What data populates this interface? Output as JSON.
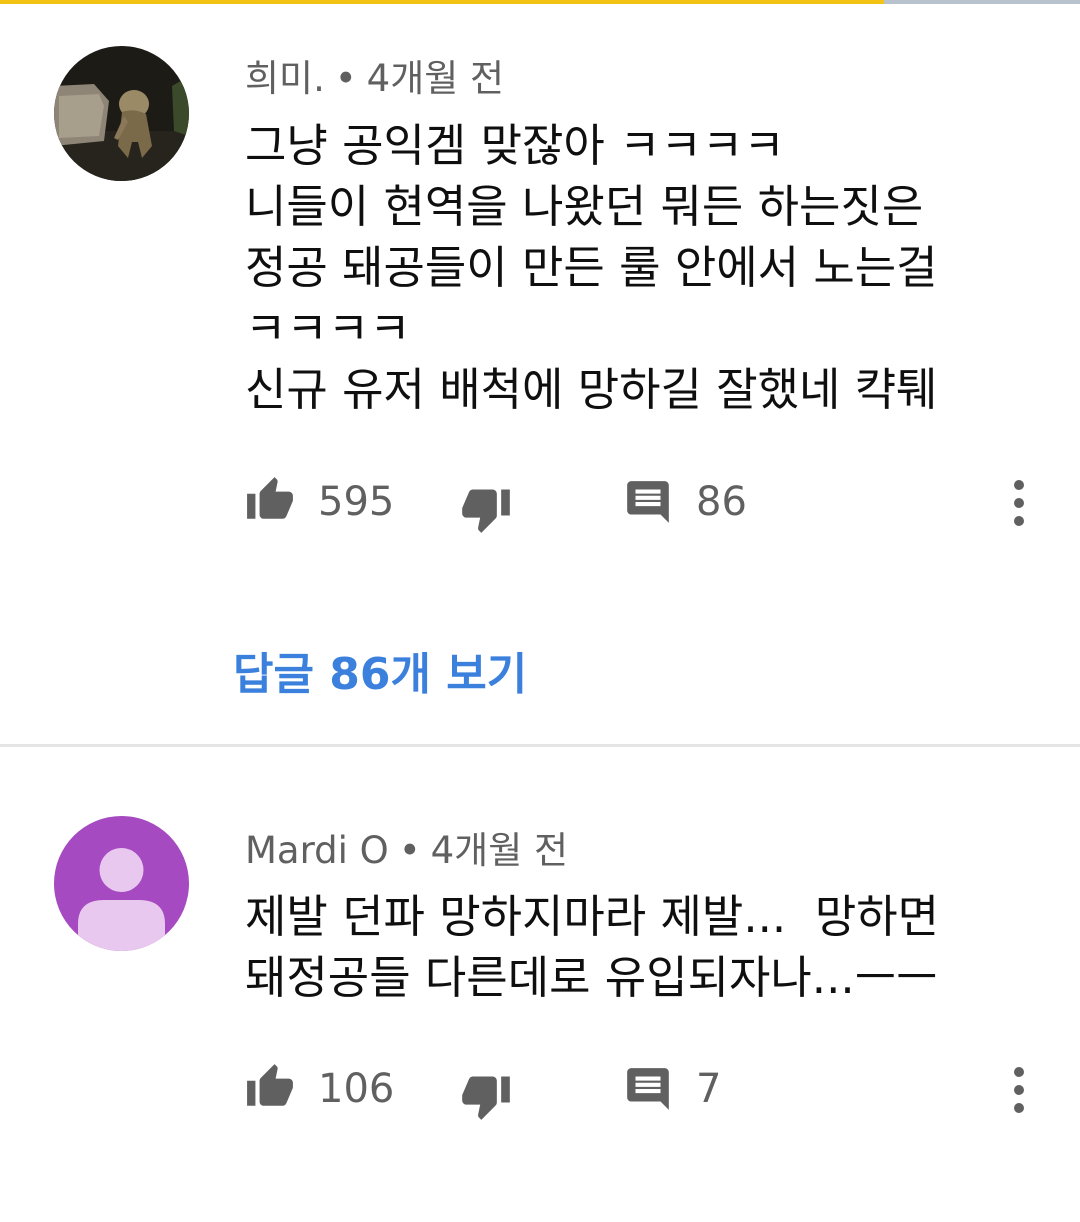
{
  "colors": {
    "progress": "#f2c314",
    "link": "#3a80dc",
    "meta": "#606060",
    "avatar_purple": "#a64ac1",
    "avatar_person": "#e8c8ee"
  },
  "comments": [
    {
      "author": "희미.",
      "time": "4개월 전",
      "avatar": "photo-avatar",
      "lines": [
        "그냥 공익겜 맞잖아 ㅋㅋㅋㅋ",
        "니들이 현역을 나왔던 뭐든 하는짓은",
        "정공 돼공들이 만든 룰 안에서 노는걸",
        "ㅋㅋㅋㅋ",
        "신규 유저 배척에 망하길 잘했네 캭퉤"
      ],
      "likes": "595",
      "replies": "86",
      "view_replies": "답글 86개 보기"
    },
    {
      "author": "Mardi O",
      "time": "4개월 전",
      "avatar": "default-person-avatar",
      "lines": [
        "제발 던파 망하지마라 제발...  망하면",
        "돼정공들 다른데로 유입되자나...ㅡㅡ"
      ],
      "likes": "106",
      "replies": "7"
    }
  ],
  "separator": "•"
}
